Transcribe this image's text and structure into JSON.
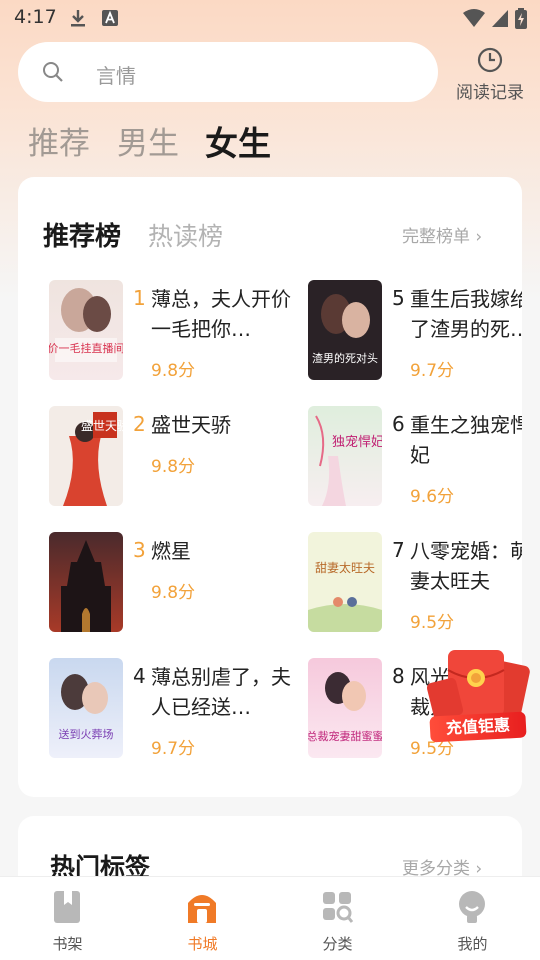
{
  "status_bar": {
    "time": "4:17"
  },
  "search": {
    "placeholder": "言情"
  },
  "header": {
    "history_label": "阅读记录"
  },
  "channel_tabs": [
    {
      "label": "推荐",
      "active": false
    },
    {
      "label": "男生",
      "active": false
    },
    {
      "label": "女生",
      "active": true
    }
  ],
  "ranking": {
    "tabs": [
      {
        "label": "推荐榜",
        "active": true
      },
      {
        "label": "热读榜",
        "active": false
      }
    ],
    "full_list_label": "完整榜单 ›",
    "books": [
      {
        "num": "1",
        "title": "薄总，夫人开价一毛把你…",
        "score": "9.8分",
        "cover_text": "开价一毛挂直播间了"
      },
      {
        "num": "2",
        "title": "盛世天骄",
        "score": "9.8分",
        "cover_text": "盛世天骄"
      },
      {
        "num": "3",
        "title": "燃星",
        "score": "9.8分",
        "cover_text": ""
      },
      {
        "num": "4",
        "title": "薄总别虐了，夫人已经送…",
        "score": "9.7分",
        "cover_text": "送到火葬场"
      },
      {
        "num": "5",
        "title": "重生后我嫁给了渣男的死…",
        "score": "9.7分",
        "cover_text": "渣男的死对头"
      },
      {
        "num": "6",
        "title": "重生之独宠悍妃",
        "score": "9.6分",
        "cover_text": "独宠悍妃"
      },
      {
        "num": "7",
        "title": "八零宠婚：萌妻太旺夫(拆…",
        "score": "9.5分",
        "cover_text": "甜妻太旺夫"
      },
      {
        "num": "8",
        "title": "风光大嫁：总裁宠妻…",
        "score": "9.5分",
        "cover_text": "总裁宠妻甜蜜蜜"
      }
    ]
  },
  "promo": {
    "label": "充值钜惠"
  },
  "hot_tags": {
    "title": "热门标签",
    "more_label": "更多分类 ›"
  },
  "bottom_nav": [
    {
      "label": "书架",
      "icon": "bookshelf-icon",
      "active": false
    },
    {
      "label": "书城",
      "icon": "bookstore-icon",
      "active": true
    },
    {
      "label": "分类",
      "icon": "category-icon",
      "active": false
    },
    {
      "label": "我的",
      "icon": "profile-icon",
      "active": false
    }
  ],
  "colors": {
    "accent": "#f07a27",
    "score": "#f2a23a",
    "promo": "#e81f1f"
  }
}
